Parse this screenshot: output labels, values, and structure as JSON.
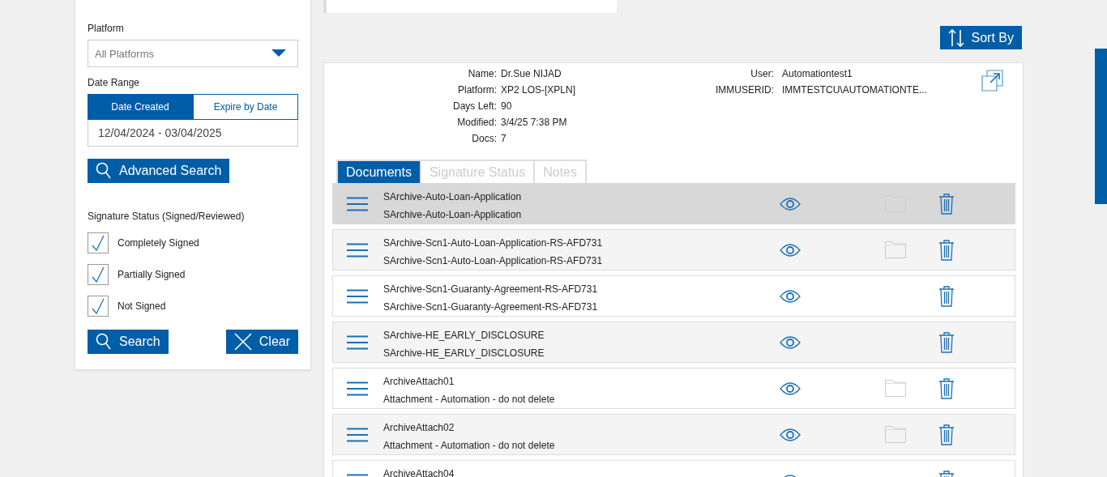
{
  "filters": {
    "platform_label": "Platform",
    "platform": {
      "value": "All Platforms"
    },
    "date_range_label": "Date Range",
    "date_modes": [
      {
        "label": "Date Created",
        "selected": true
      },
      {
        "label": "Expire by Date",
        "selected": false
      }
    ],
    "date_value": "12/04/2024 - 03/04/2025",
    "advanced_search": "Advanced Search",
    "signature_label": "Signature Status (Signed/Reviewed)",
    "signature_options": [
      {
        "label": "Completely Signed",
        "checked": true
      },
      {
        "label": "Partially Signed",
        "checked": true
      },
      {
        "label": "Not Signed",
        "checked": true
      }
    ],
    "search_button": "Search",
    "clear_button": "Clear"
  },
  "sort_button": "Sort By",
  "details": {
    "left": [
      {
        "label": "Name:",
        "value": "Dr.Sue NIJAD"
      },
      {
        "label": "Platform:",
        "value": "XP2 LOS-[XPLN]"
      },
      {
        "label": "Days Left:",
        "value": "90"
      },
      {
        "label": "Modified:",
        "value": "3/4/25 7:38 PM"
      },
      {
        "label": "Docs:",
        "value": "7"
      }
    ],
    "right": [
      {
        "label": "User:",
        "value": "Automationtest1"
      },
      {
        "label": "IMMUSERID:",
        "value": "IMMTESTCU\\AUTOMATIONTE..."
      }
    ]
  },
  "tabs": [
    {
      "label": "Documents",
      "selected": true
    },
    {
      "label": "Signature Status",
      "selected": false
    },
    {
      "label": "Notes",
      "selected": false
    }
  ],
  "documents": [
    {
      "title": "SArchive-Auto-Loan-Application",
      "subtitle": "SArchive-Auto-Loan-Application",
      "folder": true,
      "selected": true
    },
    {
      "title": "SArchive-Scn1-Auto-Loan-Application-RS-AFD731",
      "subtitle": "SArchive-Scn1-Auto-Loan-Application-RS-AFD731",
      "folder": true,
      "selected": false
    },
    {
      "title": "SArchive-Scn1-Guaranty-Agreement-RS-AFD731",
      "subtitle": "SArchive-Scn1-Guaranty-Agreement-RS-AFD731",
      "folder": false,
      "selected": false
    },
    {
      "title": "SArchive-HE_EARLY_DISCLOSURE",
      "subtitle": "SArchive-HE_EARLY_DISCLOSURE",
      "folder": false,
      "selected": false
    },
    {
      "title": "ArchiveAttach01",
      "subtitle": "Attachment - Automation - do not delete",
      "folder": true,
      "selected": false
    },
    {
      "title": "ArchiveAttach02",
      "subtitle": "Attachment - Automation - do not delete",
      "folder": true,
      "selected": false
    },
    {
      "title": "ArchiveAttach04",
      "folder": false,
      "selected": false
    }
  ]
}
